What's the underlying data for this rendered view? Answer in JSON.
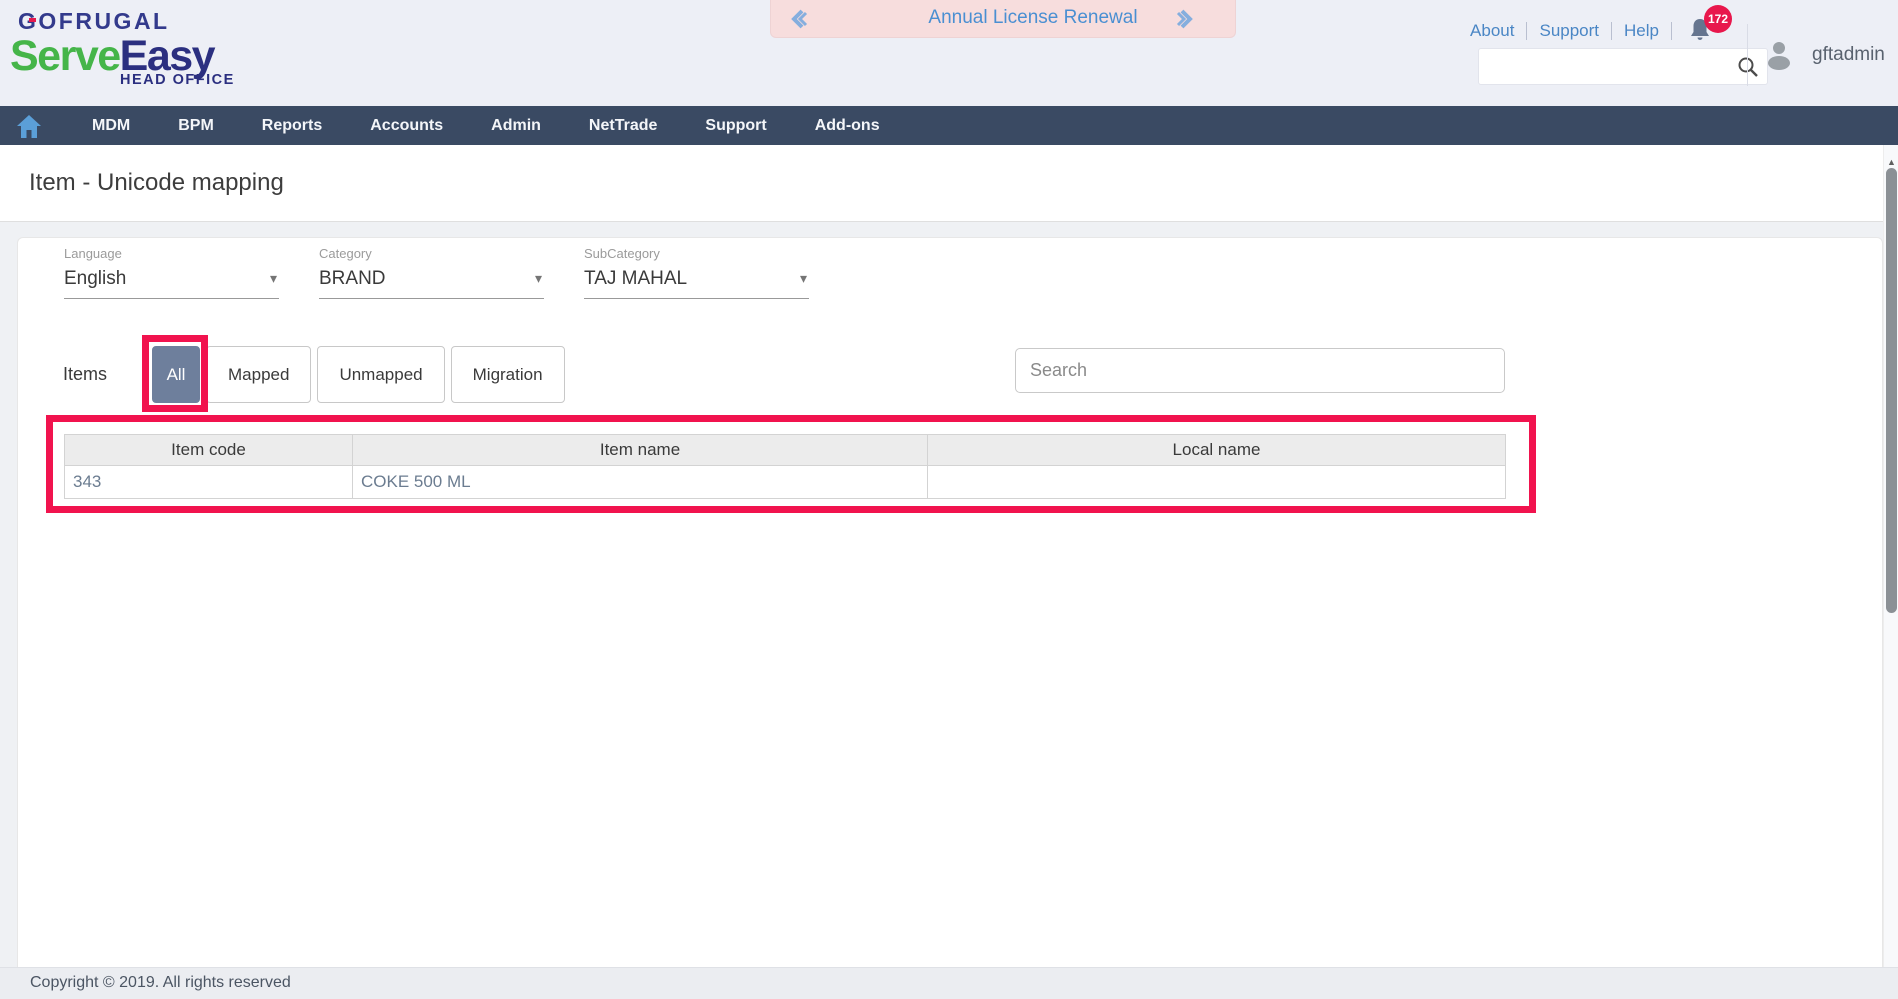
{
  "colors": {
    "navbar_bg": "#3a4a63",
    "accent_blue": "#4a86c5",
    "highlight_red": "#f1134e",
    "active_tab_bg": "#6e7f9c",
    "banner_bg": "#f7dddd",
    "badge_red": "#e8174c",
    "brand_green": "#45b549",
    "brand_navy": "#2b2f80"
  },
  "header": {
    "logo": {
      "brand": "GOFRUGAL",
      "product_part1": "Serve",
      "product_part2": "Easy",
      "tagline": "HEAD OFFICE"
    },
    "banner": {
      "text": "Annual License Renewal"
    },
    "links": [
      {
        "label": "About"
      },
      {
        "label": "Support"
      },
      {
        "label": "Help"
      }
    ],
    "notification_count": "172",
    "search_value": "",
    "username": "gftadmin"
  },
  "navbar": {
    "items": [
      "MDM",
      "BPM",
      "Reports",
      "Accounts",
      "Admin",
      "NetTrade",
      "Support",
      "Add-ons"
    ]
  },
  "page": {
    "title": "Item - Unicode mapping"
  },
  "filters": [
    {
      "label": "Language",
      "value": "English"
    },
    {
      "label": "Category",
      "value": "BRAND"
    },
    {
      "label": "SubCategory",
      "value": "TAJ MAHAL"
    }
  ],
  "tabs": {
    "group_label": "Items",
    "items": [
      {
        "label": "All",
        "active": true
      },
      {
        "label": "Mapped",
        "active": false
      },
      {
        "label": "Unmapped",
        "active": false
      },
      {
        "label": "Migration",
        "active": false
      }
    ]
  },
  "search": {
    "placeholder": "Search"
  },
  "table": {
    "columns": [
      "Item code",
      "Item name",
      "Local name"
    ],
    "rows": [
      [
        "343",
        "COKE 500 ML",
        ""
      ]
    ]
  },
  "footer": {
    "copyright": "Copyright © 2019. All rights reserved"
  },
  "icons": {
    "dropdown_arrow": "▾",
    "scroll_up": "▲"
  }
}
